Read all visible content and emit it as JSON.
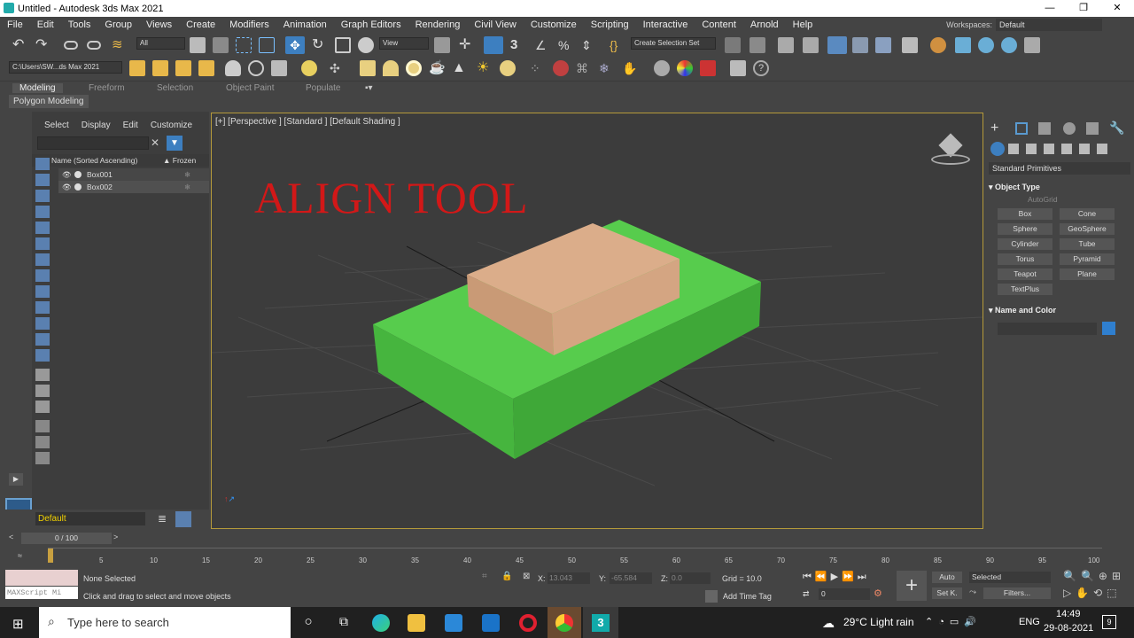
{
  "window": {
    "title": "Untitled - Autodesk 3ds Max 2021"
  },
  "menu": [
    "File",
    "Edit",
    "Tools",
    "Group",
    "Views",
    "Create",
    "Modifiers",
    "Animation",
    "Graph Editors",
    "Rendering",
    "Civil View",
    "Customize",
    "Scripting",
    "Interactive",
    "Content",
    "Arnold",
    "Help"
  ],
  "workspaces": {
    "label": "Workspaces:",
    "value": "Default"
  },
  "toolbar": {
    "selection_filter": "All",
    "ref_coord": "View",
    "selection_set": "Create Selection Set",
    "project_path": "C:\\Users\\SW...ds Max 2021"
  },
  "ribbon": {
    "tabs": [
      "Modeling",
      "Freeform",
      "Selection",
      "Object Paint",
      "Populate"
    ],
    "sub": "Polygon Modeling"
  },
  "scene_explorer": {
    "tabs": [
      "Select",
      "Display",
      "Edit",
      "Customize"
    ],
    "column_name": "Name (Sorted Ascending)",
    "column_frozen": "▲ Frozen",
    "rows": [
      "Box001",
      "Box002"
    ],
    "layer": "Default"
  },
  "viewport": {
    "label": "[+] [Perspective ] [Standard ] [Default Shading ]",
    "overlay_text": "ALIGN TOOL"
  },
  "command_panel": {
    "category": "Standard Primitives",
    "object_type_title": "Object Type",
    "autogrid": "AutoGrid",
    "buttons": [
      "Box",
      "Cone",
      "Sphere",
      "GeoSphere",
      "Cylinder",
      "Tube",
      "Torus",
      "Pyramid",
      "Teapot",
      "Plane",
      "TextPlus"
    ],
    "name_color_title": "Name and Color",
    "object_color": "#2f7fcf"
  },
  "timeline": {
    "frame": "0 / 100",
    "ticks": [
      "5",
      "10",
      "15",
      "20",
      "25",
      "30",
      "35",
      "40",
      "45",
      "50",
      "55",
      "60",
      "65",
      "70",
      "75",
      "80",
      "85",
      "90",
      "95",
      "100"
    ]
  },
  "status": {
    "maxscript": "MAXScript Mi",
    "selected": "None Selected",
    "prompt": "Click and drag to select and move objects",
    "x_label": "X:",
    "x": "13.043",
    "y_label": "Y:",
    "y": "-65.584",
    "z_label": "Z:",
    "z": "0.0",
    "grid": "Grid = 10.0",
    "add_time_tag": "Add Time Tag",
    "auto": "Auto",
    "selected_dd": "Selected",
    "setk": "Set K.",
    "filters": "Filters...",
    "frame_field": "0"
  },
  "taskbar": {
    "search": "Type here to search",
    "weather": "29°C  Light rain",
    "lang": "ENG",
    "time": "14:49",
    "date": "29-08-2021",
    "notif": "9"
  },
  "colors": {
    "green_box": "#52c249",
    "tan_box": "#d7a884",
    "align_text": "#d21818"
  }
}
